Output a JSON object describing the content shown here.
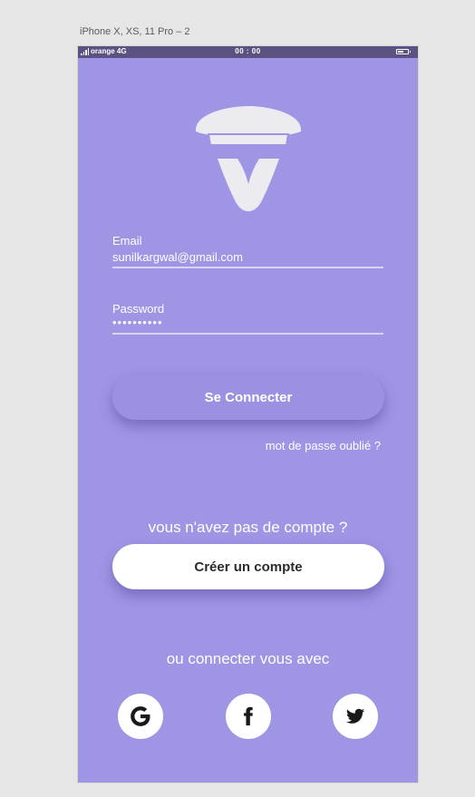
{
  "artboard": {
    "label": "iPhone X, XS, 11 Pro – 2"
  },
  "statusbar": {
    "carrier": "orange 4G",
    "time": "00 : 00"
  },
  "form": {
    "email": {
      "label": "Email",
      "value": "sunilkargwal@gmail.com"
    },
    "password": {
      "label": "Password",
      "masked_value": "••••••••••"
    }
  },
  "actions": {
    "login_label": "Se Connecter",
    "forgot_password": "mot de passe oublié ?",
    "no_account": "vous n'avez pas de compte ?",
    "create_account_label": "Créer un compte",
    "connect_with": "ou connecter vous avec"
  },
  "social": [
    {
      "name": "google",
      "icon": "google-icon"
    },
    {
      "name": "facebook",
      "icon": "facebook-icon"
    },
    {
      "name": "twitter",
      "icon": "twitter-icon"
    }
  ],
  "colors": {
    "background": "#9f95e5",
    "statusbar": "#5b5282",
    "button_primary": "#9b91e2",
    "button_secondary": "#ffffff",
    "logo": "#ececf0"
  }
}
